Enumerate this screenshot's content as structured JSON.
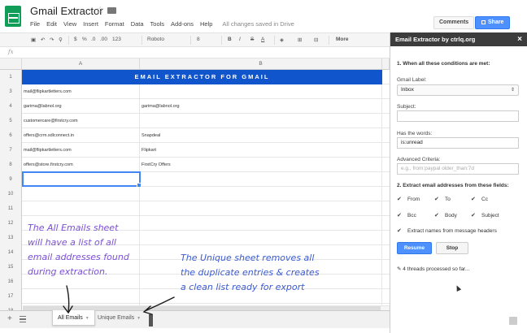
{
  "app": {
    "title": "Gmail Extractor",
    "menu": [
      "File",
      "Edit",
      "View",
      "Insert",
      "Format",
      "Data",
      "Tools",
      "Add-ons",
      "Help"
    ],
    "save_status": "All changes saved in Drive",
    "comments_label": "Comments",
    "share_label": "Share"
  },
  "toolbar": {
    "currency": "$",
    "percent": "%",
    "decimal_less": ".0",
    "decimal_more": ".00",
    "number_format": "123",
    "font": "Roboto",
    "font_size": "8",
    "bold": "B",
    "italic": "I",
    "strike": "S",
    "text_color": "A",
    "more": "More"
  },
  "formula_bar": {
    "fx": "fx"
  },
  "grid": {
    "columns": [
      "A",
      "B"
    ],
    "banner": "EMAIL EXTRACTOR FOR GMAIL",
    "rows": [
      {
        "num": "1",
        "a": "",
        "b": ""
      },
      {
        "num": "3",
        "a": "mail@flipkartletters.com",
        "b": ""
      },
      {
        "num": "4",
        "a": "garima@labnol.org",
        "b": "garima@labnol.org"
      },
      {
        "num": "5",
        "a": "customercare@firstcry.com",
        "b": ""
      },
      {
        "num": "6",
        "a": "offers@crm.sdlconnect.in",
        "b": "Snapdeal"
      },
      {
        "num": "7",
        "a": "mail@flipkartletters.com",
        "b": "Flipkart"
      },
      {
        "num": "8",
        "a": "offers@store.firstcry.com",
        "b": "FirstCry Offers"
      },
      {
        "num": "9",
        "a": "",
        "b": ""
      },
      {
        "num": "10",
        "a": "",
        "b": ""
      },
      {
        "num": "11",
        "a": "",
        "b": ""
      },
      {
        "num": "12",
        "a": "",
        "b": ""
      },
      {
        "num": "13",
        "a": "",
        "b": ""
      },
      {
        "num": "14",
        "a": "",
        "b": ""
      },
      {
        "num": "15",
        "a": "",
        "b": ""
      },
      {
        "num": "16",
        "a": "",
        "b": ""
      },
      {
        "num": "17",
        "a": "",
        "b": ""
      },
      {
        "num": "18",
        "a": "",
        "b": ""
      }
    ]
  },
  "sheet_tabs": {
    "add": "+",
    "tabs": [
      {
        "label": "All Emails",
        "active": true
      },
      {
        "label": "Unique Emails",
        "active": false
      }
    ]
  },
  "annotations": {
    "purple_note": "The All Emails sheet\nwill have a list of all\nemail addresses found\nduring extraction.",
    "blue_note": "The Unique sheet removes all\nthe duplicate entries & creates\na clean list ready for export",
    "purple_color": "#7b4fd6",
    "blue_color": "#3b5bd0"
  },
  "sidebar": {
    "title": "Email Extractor by ctrlq.org",
    "close": "×",
    "section1": "1. When all these conditions are met:",
    "gmail_label_label": "Gmail Label:",
    "gmail_label_value": "Inbox",
    "subject_label": "Subject:",
    "subject_value": "",
    "has_words_label": "Has the words:",
    "has_words_value": "is:unread",
    "advanced_label": "Advanced Criteria:",
    "advanced_placeholder": "e.g., from:paypal older_than:7d",
    "section2": "2. Extract email addresses from these fields:",
    "fields": [
      {
        "label": "From",
        "checked": true
      },
      {
        "label": "To",
        "checked": true
      },
      {
        "label": "Cc",
        "checked": true
      },
      {
        "label": "Bcc",
        "checked": true
      },
      {
        "label": "Body",
        "checked": true
      },
      {
        "label": "Subject",
        "checked": true
      }
    ],
    "extract_names_label": "Extract names from message headers",
    "resume_label": "Resume",
    "stop_label": "Stop",
    "status": "4 threads processed so far..."
  }
}
